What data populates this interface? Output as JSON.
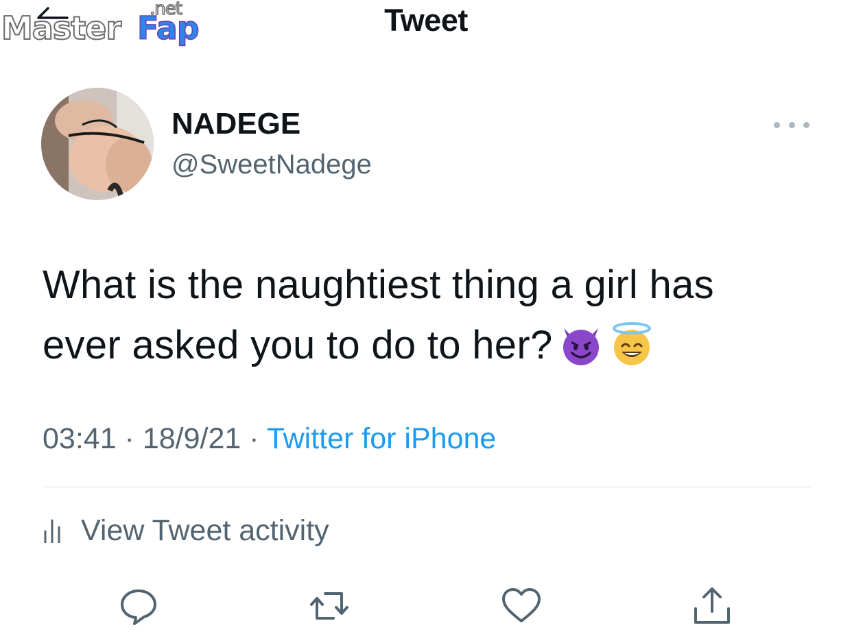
{
  "watermark": {
    "master": "Master",
    "fap": "Fap",
    "net": ".net"
  },
  "header": {
    "title": "Tweet",
    "back_icon": "back-arrow-icon"
  },
  "author": {
    "display_name": "NADEGE",
    "handle": "@SweetNadege"
  },
  "tweet": {
    "text_line1": "What is the naughtiest thing a girl has",
    "text_line2": "ever asked you to do to her?",
    "emojis": [
      "smiling-devil-emoji",
      "smiling-halo-emoji"
    ]
  },
  "meta": {
    "time": "03:41",
    "sep1": " · ",
    "date": "18/9/21",
    "sep2": " · ",
    "source": "Twitter for iPhone"
  },
  "activity": {
    "label": "View Tweet activity"
  },
  "actions": [
    "reply-icon",
    "retweet-icon",
    "like-icon",
    "share-icon"
  ],
  "colors": {
    "text_primary": "#0f1419",
    "text_secondary": "#536471",
    "link": "#1d9bf0",
    "divider": "#dcdfe2"
  }
}
